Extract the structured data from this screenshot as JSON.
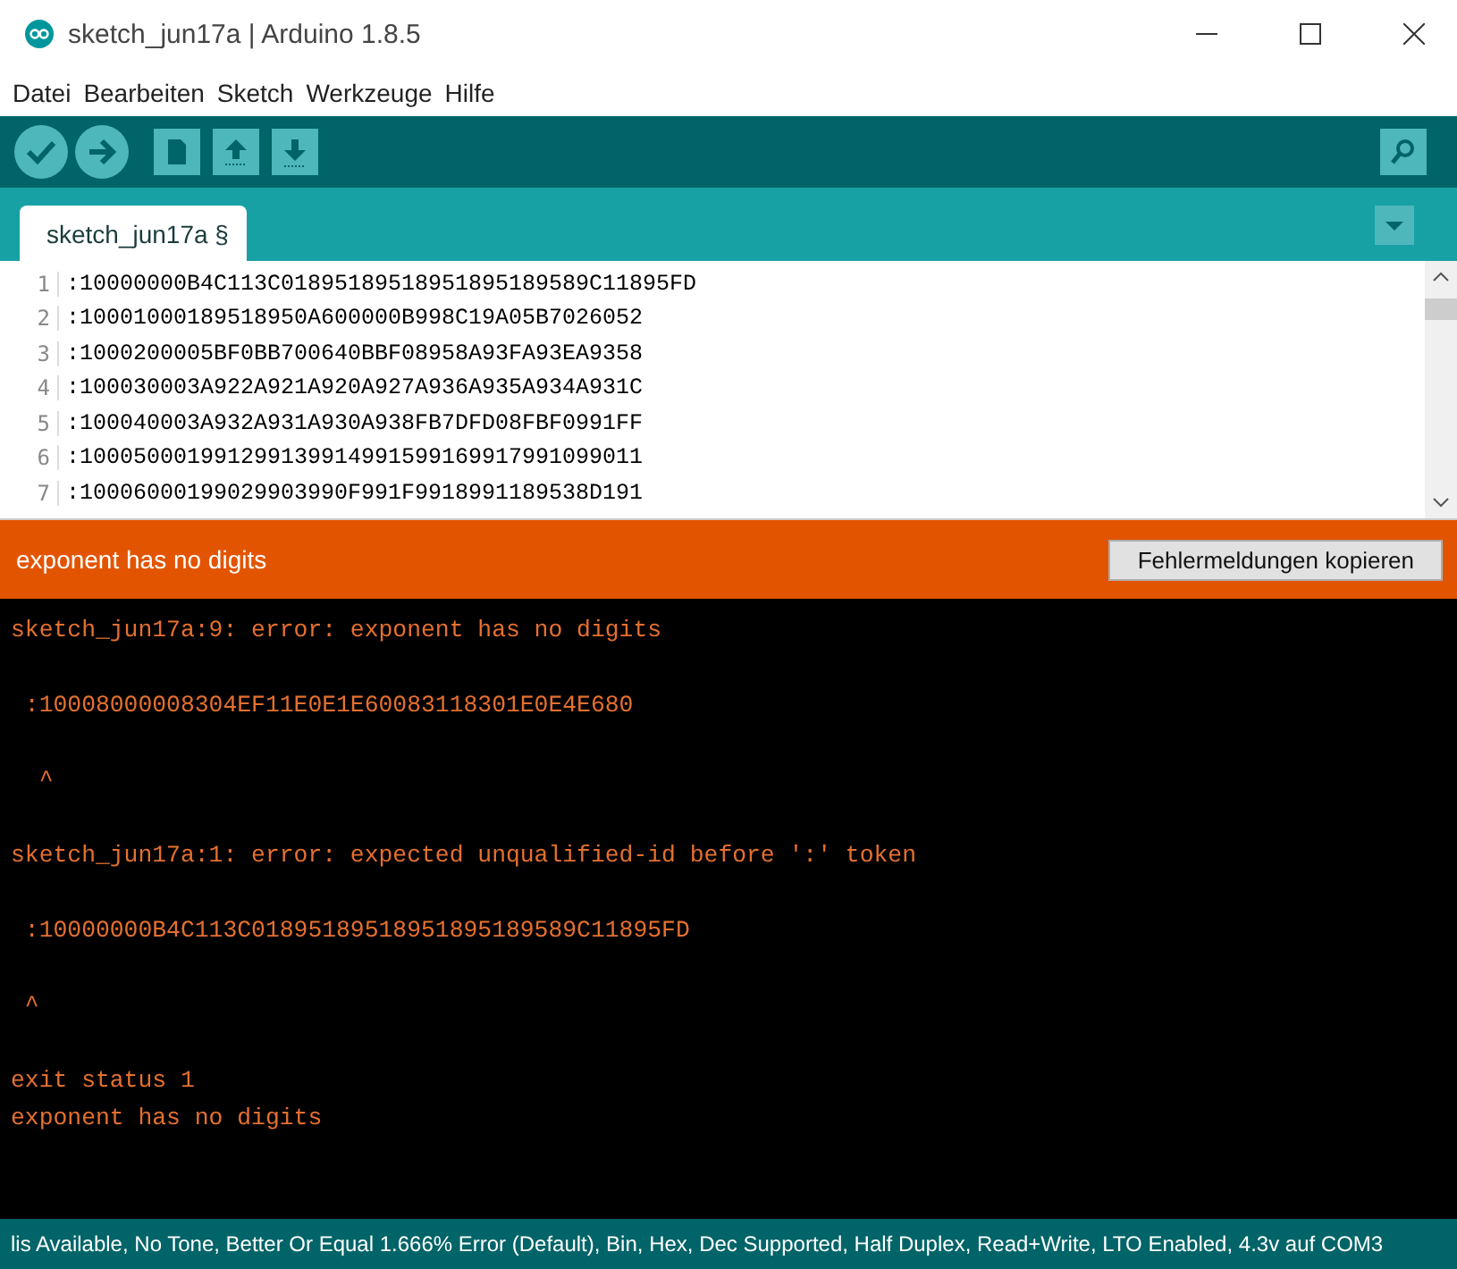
{
  "window": {
    "title": "sketch_jun17a | Arduino 1.8.5"
  },
  "menu": [
    "Datei",
    "Bearbeiten",
    "Sketch",
    "Werkzeuge",
    "Hilfe"
  ],
  "tabs": [
    {
      "label": "sketch_jun17a §",
      "selected": true
    }
  ],
  "editor": {
    "lines": [
      {
        "number": "1",
        "text": ":10000000B4C113C01895189518951895189589C11895FD"
      },
      {
        "number": "2",
        "text": ":10001000189518950A600000B998C19A05B7026052"
      },
      {
        "number": "3",
        "text": ":1000200005BF0BB700640BBF08958A93FA93EA9358"
      },
      {
        "number": "4",
        "text": ":100030003A922A921A920A927A936A935A934A931C"
      },
      {
        "number": "5",
        "text": ":100040003A932A931A930A938FB7DFD08FBF0991FF"
      },
      {
        "number": "6",
        "text": ":100050001991299139914991599169917991099011"
      },
      {
        "number": "7",
        "text": ":10006000199029903990F991F9918991189538D191"
      }
    ]
  },
  "message_bar": {
    "text": "exponent has no digits",
    "button": "Fehlermeldungen kopieren"
  },
  "console": "sketch_jun17a:9: error: exponent has no digits\n\n :10008000008304EF11E0E1E60083118301E0E4E680\n\n  ^\n\nsketch_jun17a:1: error: expected unqualified-id before ':' token\n\n :10000000B4C113C01895189518951895189589C11895FD\n\n ^\n\nexit status 1\nexponent has no digits",
  "status_bar": "lis Available, No Tone, Better Or Equal 1.666% Error (Default), Bin, Hex, Dec Supported, Half Duplex, Read+Write, LTO Enabled, 4.3v auf COM3"
}
